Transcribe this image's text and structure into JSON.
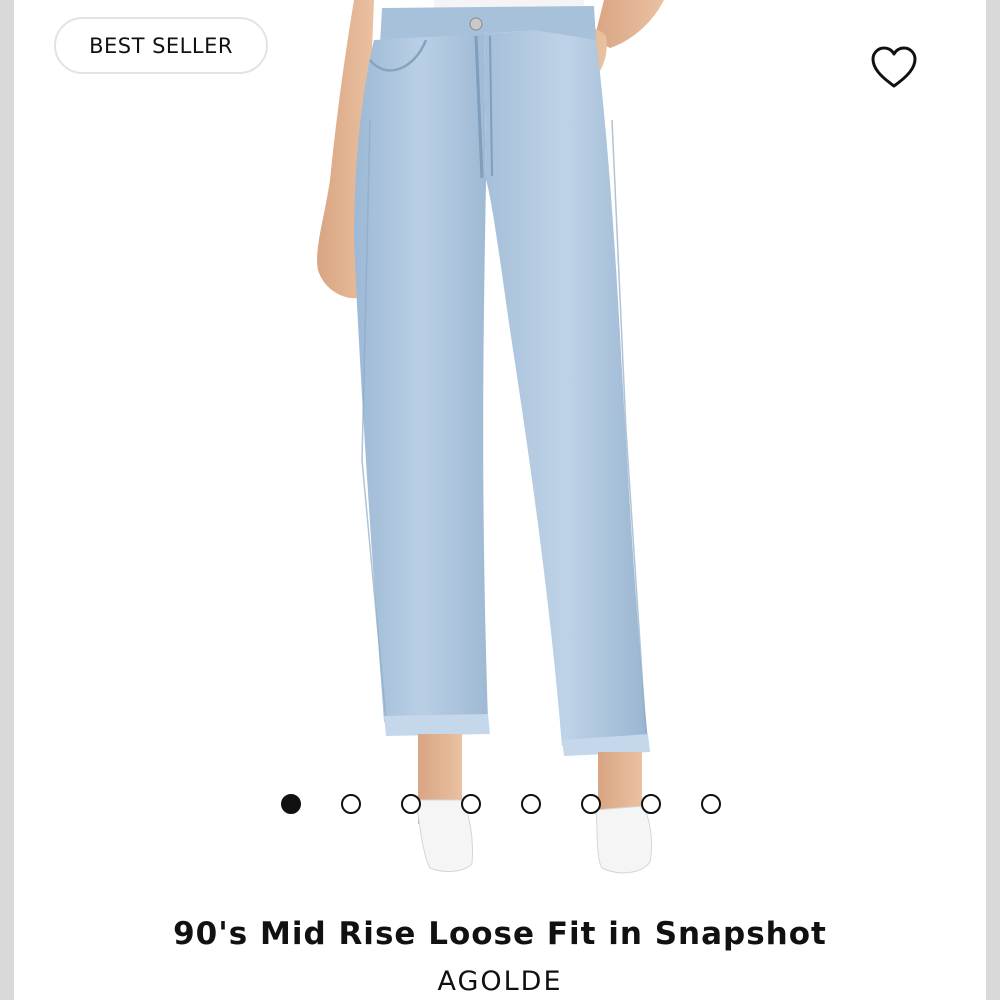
{
  "product": {
    "badge": "BEST SELLER",
    "title": "90's Mid Rise Loose Fit in Snapshot",
    "brand": "AGOLDE"
  },
  "gallery": {
    "image_count": 8,
    "active_index": 0
  },
  "icons": {
    "favorite": "heart-outline-icon"
  },
  "colors": {
    "background": "#ffffff",
    "denim": "#a9c3dc",
    "text": "#111111"
  }
}
